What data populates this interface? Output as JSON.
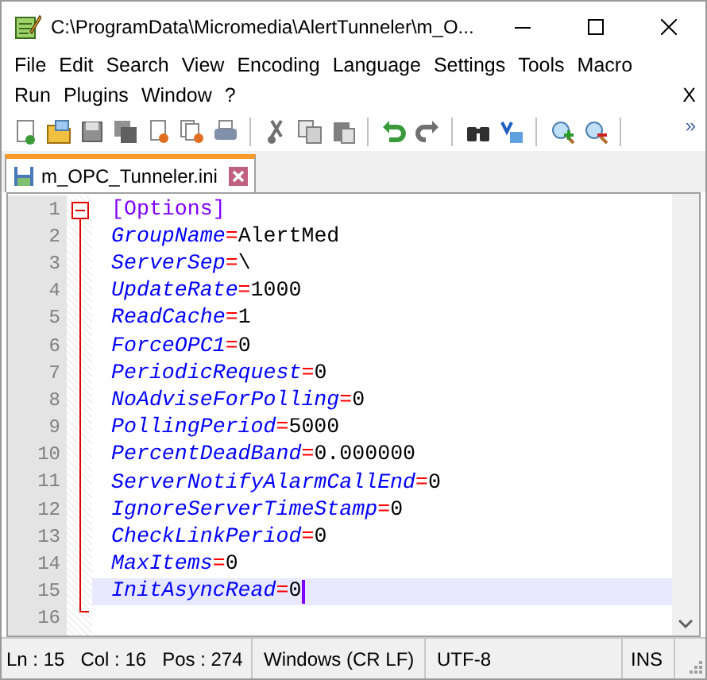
{
  "window": {
    "title": "C:\\ProgramData\\Micromedia\\AlertTunneler\\m_O..."
  },
  "menu": {
    "items": [
      "File",
      "Edit",
      "Search",
      "View",
      "Encoding",
      "Language",
      "Settings",
      "Tools",
      "Macro",
      "Run",
      "Plugins",
      "Window",
      "?"
    ],
    "close_document": "X"
  },
  "toolbar": {
    "overflow": "»"
  },
  "tabs": [
    {
      "label": "m_OPC_Tunneler.ini",
      "selected": true
    }
  ],
  "editor": {
    "lines": [
      {
        "number": "1",
        "kind": "section",
        "text": "[Options]",
        "current": false
      },
      {
        "number": "2",
        "kind": "pair",
        "key": "GroupName",
        "operator": "=",
        "value": "AlertMed",
        "current": false
      },
      {
        "number": "3",
        "kind": "pair",
        "key": "ServerSep",
        "operator": "=",
        "value": "\\",
        "current": false
      },
      {
        "number": "4",
        "kind": "pair",
        "key": "UpdateRate",
        "operator": "=",
        "value": "1000",
        "current": false
      },
      {
        "number": "5",
        "kind": "pair",
        "key": "ReadCache",
        "operator": "=",
        "value": "1",
        "current": false
      },
      {
        "number": "6",
        "kind": "pair",
        "key": "ForceOPC1",
        "operator": "=",
        "value": "0",
        "current": false
      },
      {
        "number": "7",
        "kind": "pair",
        "key": "PeriodicRequest",
        "operator": "=",
        "value": "0",
        "current": false
      },
      {
        "number": "8",
        "kind": "pair",
        "key": "NoAdviseForPolling",
        "operator": "=",
        "value": "0",
        "current": false
      },
      {
        "number": "9",
        "kind": "pair",
        "key": "PollingPeriod",
        "operator": "=",
        "value": "5000",
        "current": false
      },
      {
        "number": "10",
        "kind": "pair",
        "key": "PercentDeadBand",
        "operator": "=",
        "value": "0.000000",
        "current": false
      },
      {
        "number": "11",
        "kind": "pair",
        "key": "ServerNotifyAlarmCallEnd",
        "operator": "=",
        "value": "0",
        "current": false
      },
      {
        "number": "12",
        "kind": "pair",
        "key": "IgnoreServerTimeStamp",
        "operator": "=",
        "value": "0",
        "current": false
      },
      {
        "number": "13",
        "kind": "pair",
        "key": "CheckLinkPeriod",
        "operator": "=",
        "value": "0",
        "current": false
      },
      {
        "number": "14",
        "kind": "pair",
        "key": "MaxItems",
        "operator": "=",
        "value": "0",
        "current": false
      },
      {
        "number": "15",
        "kind": "pair",
        "key": "InitAsyncRead",
        "operator": "=",
        "value": "0",
        "current": true
      },
      {
        "number": "16",
        "kind": "empty",
        "current": false
      }
    ]
  },
  "status_bar": {
    "position": [
      "Ln : 15",
      "Col : 16",
      "Pos : 274"
    ],
    "eol": "Windows (CR LF)",
    "encoding": "UTF-8",
    "mode": "INS"
  }
}
